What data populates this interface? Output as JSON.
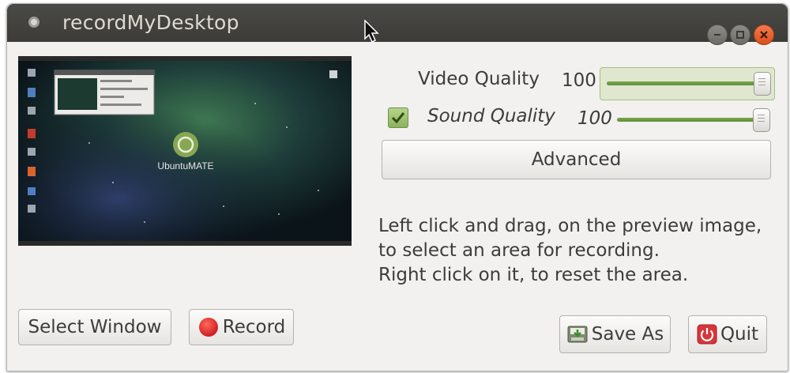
{
  "window": {
    "title": "recordMyDesktop"
  },
  "video_quality": {
    "label": "Video Quality",
    "value": "100",
    "level": 1.0
  },
  "sound_quality": {
    "label": "Sound Quality",
    "value": "100",
    "level": 1.0,
    "enabled": true
  },
  "buttons": {
    "advanced": "Advanced",
    "select_window": "Select Window",
    "record": "Record",
    "save_as": "Save As",
    "quit": "Quit"
  },
  "instructions": [
    "Left click and drag, on the preview image,",
    "to select an area for recording.",
    "Right click on it, to reset the area."
  ],
  "preview": {
    "desktop_logo_text": "UbuntuMATE"
  },
  "colors": {
    "accent_green": "#6a9a3e",
    "record_red": "#e02a2a",
    "quit_red": "#d8353a",
    "titlebar": "#3c3b37"
  },
  "icons": [
    "app-icon",
    "minimize-icon",
    "maximize-icon",
    "close-icon",
    "check-icon",
    "record-icon",
    "save-icon",
    "power-icon"
  ]
}
